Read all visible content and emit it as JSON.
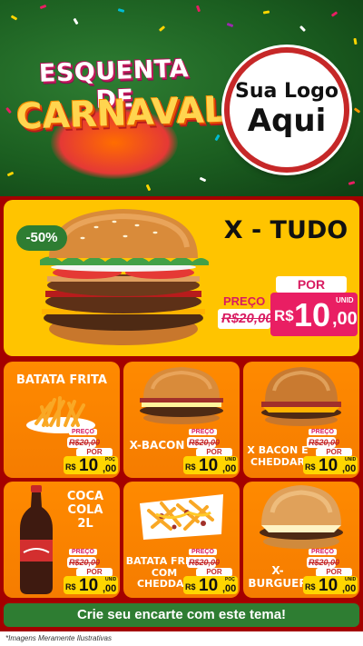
{
  "header": {
    "title_line1": "ESQUENTA DE",
    "title_line2": "CARNAVAL",
    "logo_line1": "Sua Logo",
    "logo_line2": "Aqui",
    "bg_color": "#1b5e20",
    "ring_color": "#c62828"
  },
  "hero": {
    "title": "X - TUDO",
    "discount": "-50%",
    "price_label": "PREÇO",
    "old_price": "R$20,00",
    "por_label": "POR",
    "currency": "R$",
    "price_int": "10",
    "price_cents": ",00",
    "unit": "UNID",
    "image": "burger-image"
  },
  "products": [
    {
      "name": "BATATA FRITA",
      "price_label": "PREÇO",
      "old_price": "R$20,00",
      "por_label": "POR",
      "currency": "R$",
      "price_int": "10",
      "price_cents": ",00",
      "unit": "POÇ",
      "image": "fries-image"
    },
    {
      "name": "X-BACON",
      "price_label": "PREÇO",
      "old_price": "R$20,00",
      "por_label": "POR",
      "currency": "R$",
      "price_int": "10",
      "price_cents": ",00",
      "unit": "UNID",
      "image": "burger-image"
    },
    {
      "name": "X BACON E CHEDDAR",
      "price_label": "PREÇO",
      "old_price": "R$20,00",
      "por_label": "POR",
      "currency": "R$",
      "price_int": "10",
      "price_cents": ",00",
      "unit": "UNID",
      "image": "burger-image"
    },
    {
      "name": "COCA COLA 2L",
      "price_label": "PREÇO",
      "old_price": "R$20,00",
      "por_label": "POR",
      "currency": "R$",
      "price_int": "10",
      "price_cents": ",00",
      "unit": "UNID",
      "image": "soda-bottle-image"
    },
    {
      "name": "BATATA FRITA COM CHEDDAR",
      "price_label": "PREÇO",
      "old_price": "R$20,00",
      "por_label": "POR",
      "currency": "R$",
      "price_int": "10",
      "price_cents": ",00",
      "unit": "POÇ",
      "image": "fries-cheddar-image"
    },
    {
      "name": "X-BURGUER",
      "price_label": "PREÇO",
      "old_price": "R$20,00",
      "por_label": "POR",
      "currency": "R$",
      "price_int": "10",
      "price_cents": ",00",
      "unit": "UNID",
      "image": "burger-image"
    }
  ],
  "cta": "Crie seu encarte com este tema!",
  "footnote": "*Imagens Meramente Ilustrativas",
  "colors": {
    "accent_pink": "#e91e63",
    "price_yellow": "#ffd600",
    "card_orange": "#f57c00",
    "hero_yellow": "#ffc400",
    "panel_red": "#a40000",
    "cta_green": "#2e7d32"
  }
}
